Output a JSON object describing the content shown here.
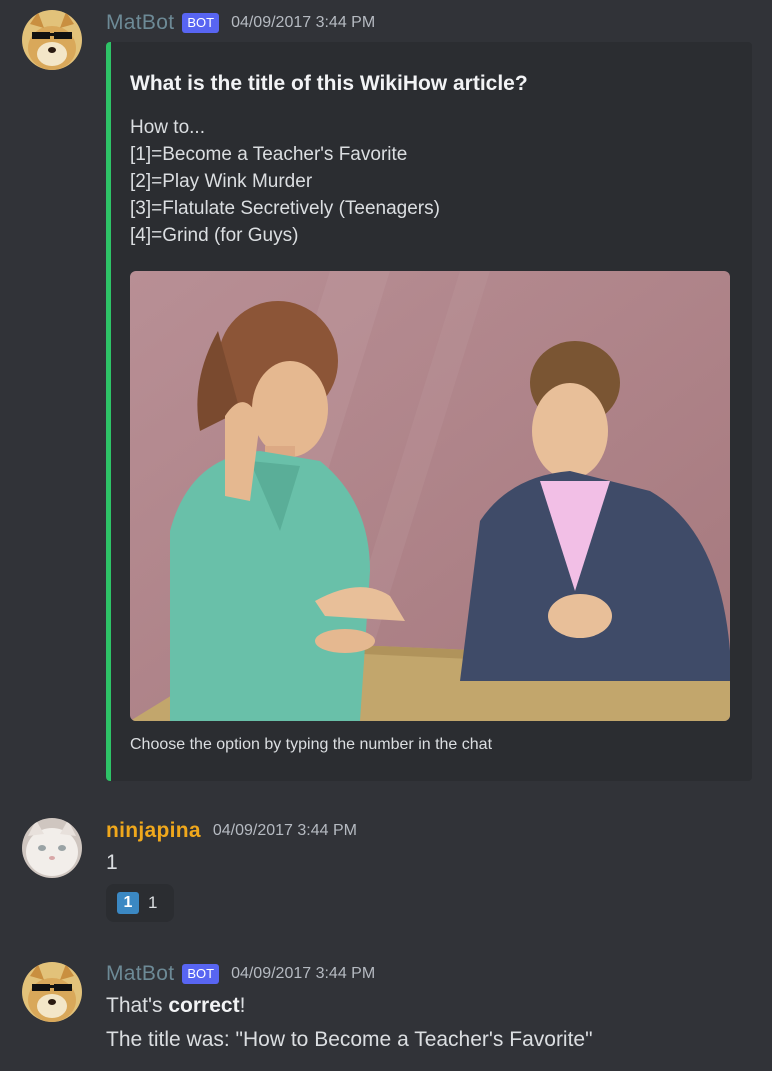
{
  "messages": [
    {
      "username": "MatBot",
      "bot_tag": "BOT",
      "timestamp": "04/09/2017 3:44 PM",
      "avatar": "doge-sunglasses-avatar",
      "embed": {
        "accent_color": "#2ec367",
        "title": "What is the title of this WikiHow article?",
        "description": [
          "How to...",
          "[1]=Become a Teacher's Favorite",
          "[2]=Play Wink Murder",
          "[3]=Flatulate Secretively (Teenagers)",
          "[4]=Grind (for Guys)"
        ],
        "image": "wikihow-illustration-woman-and-man-talking-at-table",
        "footer": "Choose the option by typing the number in the chat"
      }
    },
    {
      "username": "ninjapina",
      "timestamp": "04/09/2017 3:44 PM",
      "avatar": "white-cat-avatar",
      "content": "1",
      "reaction": {
        "emoji": "keycap-one-icon",
        "emoji_text": "1",
        "count": "1"
      }
    },
    {
      "username": "MatBot",
      "bot_tag": "BOT",
      "timestamp": "04/09/2017 3:44 PM",
      "avatar": "doge-sunglasses-avatar",
      "content_prefix": "That's ",
      "content_bold": "correct",
      "content_suffix": "!",
      "content_line2": "The title was: \"How to Become a Teacher's Favorite\""
    }
  ],
  "colors": {
    "background": "#313338",
    "embed_background": "#2b2d31",
    "bot_tag": "#5865f2",
    "bot_name": "#6d8a96",
    "user_name": "#f0a81c"
  }
}
